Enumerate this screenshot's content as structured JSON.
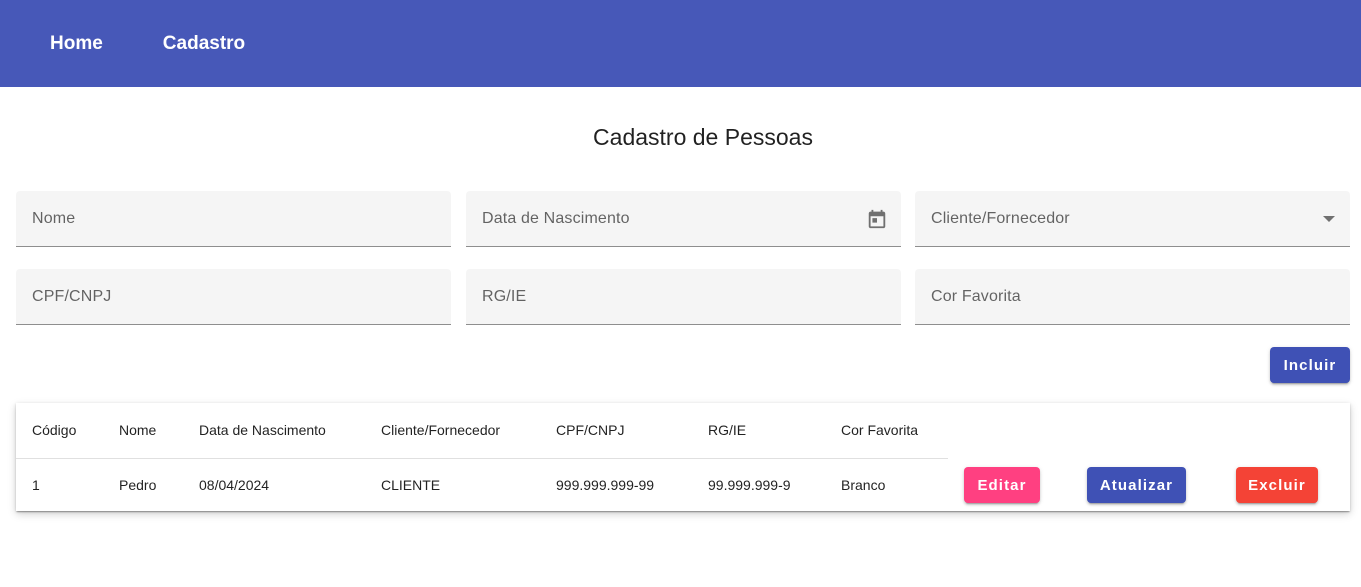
{
  "nav": {
    "items": [
      {
        "label": "Home"
      },
      {
        "label": "Cadastro"
      }
    ]
  },
  "page": {
    "title": "Cadastro de Pessoas"
  },
  "form": {
    "nome": {
      "placeholder": "Nome",
      "value": ""
    },
    "data_nascimento": {
      "placeholder": "Data de Nascimento",
      "value": "",
      "icon": "calendar-icon"
    },
    "cliente_fornecedor": {
      "label": "Cliente/Fornecedor",
      "value": "",
      "icon": "dropdown-arrow-icon"
    },
    "cpf_cnpj": {
      "placeholder": "CPF/CNPJ",
      "value": ""
    },
    "rg_ie": {
      "placeholder": "RG/IE",
      "value": ""
    },
    "cor_favorita": {
      "placeholder": "Cor Favorita",
      "value": ""
    },
    "submit_label": "Incluir"
  },
  "table": {
    "columns": [
      "Código",
      "Nome",
      "Data de Nascimento",
      "Cliente/Fornecedor",
      "CPF/CNPJ",
      "RG/IE",
      "Cor Favorita"
    ],
    "rows": [
      {
        "cells": [
          "1",
          "Pedro",
          "08/04/2024",
          "CLIENTE",
          "999.999.999-99",
          "99.999.999-9",
          "Branco"
        ],
        "actions": {
          "edit": "Editar",
          "update": "Atualizar",
          "delete": "Excluir"
        }
      }
    ]
  },
  "colors": {
    "toolbar": "#4758b8",
    "primary": "#3f51b5",
    "accent": "#ff4081",
    "warn": "#f44336",
    "field_background": "#f5f5f5"
  }
}
